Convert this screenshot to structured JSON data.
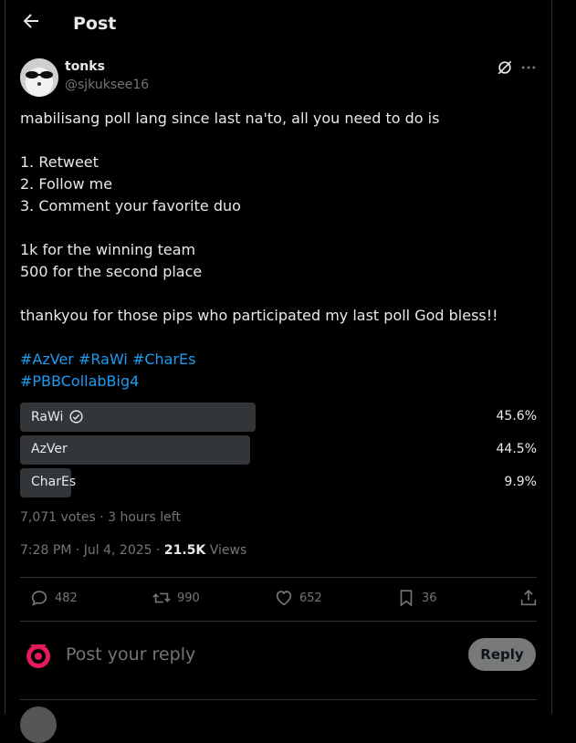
{
  "header": {
    "title": "Post"
  },
  "author": {
    "name": "tonks",
    "handle": "@sjkuksee16"
  },
  "post": {
    "lines": [
      "mabilisang poll lang since last na'to, all you need to do is",
      "",
      "1. Retweet",
      "2. Follow me",
      "3. Comment your favorite duo",
      "",
      "1k for the winning team",
      "500 for the second place",
      "",
      "thankyou for those pips who participated my last poll God bless!!",
      ""
    ],
    "hashtags_line1": "#AzVer #RaWi #CharEs",
    "hashtags_line2": "#PBBCollabBig4"
  },
  "poll": {
    "options": [
      {
        "label": "RaWi",
        "percent": "45.6%",
        "fraction": 0.456,
        "winner": true
      },
      {
        "label": "AzVer",
        "percent": "44.5%",
        "fraction": 0.445,
        "winner": false
      },
      {
        "label": "CharEs",
        "percent": "9.9%",
        "fraction": 0.099,
        "winner": false
      }
    ],
    "summary": "7,071 votes · 3 hours left"
  },
  "meta": {
    "time": "7:28 PM · Jul 4, 2025 · ",
    "views_count": "21.5K",
    "views_label": " Views"
  },
  "actions": {
    "replies": "482",
    "reposts": "990",
    "likes": "652",
    "bookmarks": "36"
  },
  "reply": {
    "placeholder": "Post your reply",
    "button": "Reply"
  },
  "colors": {
    "background": "#000000",
    "text": "#e7e9ea",
    "muted": "#71767b",
    "link": "#1d9bf0",
    "poll_bar": "#333639",
    "reply_button": "#787a7a"
  }
}
